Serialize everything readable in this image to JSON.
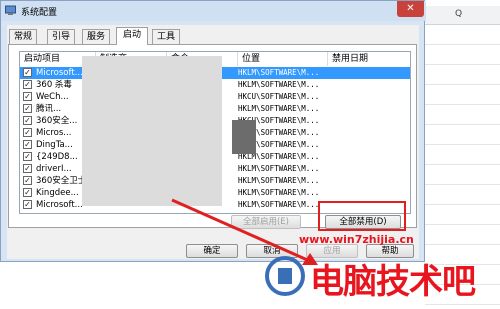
{
  "window": {
    "title": "系统配置",
    "close_glyph": "✕"
  },
  "tabs": [
    {
      "label": "常规"
    },
    {
      "label": "引导"
    },
    {
      "label": "服务"
    },
    {
      "label": "启动"
    },
    {
      "label": "工具"
    }
  ],
  "active_tab": "启动",
  "columns": {
    "item": "启动项目",
    "manufacturer": "制造商",
    "command": "命令",
    "location": "位置",
    "disabled_date": "禁用日期"
  },
  "rows": [
    {
      "name": "Microsoft...",
      "location": "HKLM\\SOFTWARE\\M...",
      "checked": true,
      "selected": true
    },
    {
      "name": "360 杀毒",
      "location": "HKLM\\SOFTWARE\\M...",
      "checked": true
    },
    {
      "name": "WeCh...",
      "location": "HKCU\\SOFTWARE\\M...",
      "checked": true
    },
    {
      "name": "腾讯...",
      "location": "HKLM\\SOFTWARE\\M...",
      "checked": true
    },
    {
      "name": "360安全...",
      "location": "HKCU\\SOFTWARE\\M...",
      "checked": true
    },
    {
      "name": "Micros...",
      "location": "HKCU\\SOFTWARE\\M...",
      "checked": true
    },
    {
      "name": "DingTa...",
      "location": "HKCU\\SOFTWARE\\M...",
      "checked": true
    },
    {
      "name": "{249D8...",
      "location": "HKLM\\SOFTWARE\\M...",
      "checked": true
    },
    {
      "name": "driverI...",
      "location": "HKLM\\SOFTWARE\\M...",
      "checked": true
    },
    {
      "name": "360安全卫士...",
      "location": "HKLM\\SOFTWARE\\M...",
      "checked": true
    },
    {
      "name": "Kingdee...",
      "location": "HKLM\\SOFTWARE\\M...",
      "checked": true
    },
    {
      "name": "Microsoft...",
      "location": "HKLM\\SOFTWARE\\M...",
      "checked": true
    }
  ],
  "check_glyph": "✓",
  "buttons": {
    "enable_all": "全部启用(E)",
    "disable_all": "全部禁用(D)",
    "ok": "确定",
    "cancel": "取消",
    "apply": "应用",
    "help": "帮助"
  },
  "spreadsheet": {
    "column_header": "Q"
  },
  "watermark": {
    "url": "www.win7zhijia.cn",
    "text": "电脑技术吧"
  },
  "colors": {
    "highlight": "#e02020",
    "selection": "#3399ff",
    "watermark": "#e8141e"
  }
}
